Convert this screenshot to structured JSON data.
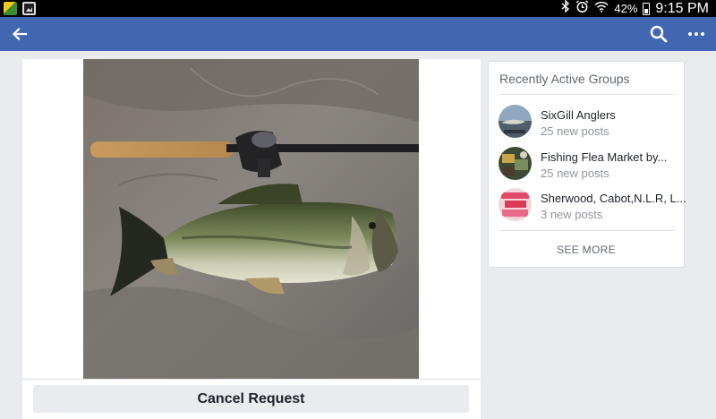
{
  "status_bar": {
    "battery": "42%",
    "time": "9:15 PM",
    "icons": [
      "app-icon",
      "gallery-icon",
      "bluetooth-icon",
      "alarm-icon",
      "wifi-icon",
      "battery-icon"
    ]
  },
  "app_bar": {
    "back_icon": "back-arrow-icon",
    "search_icon": "search-icon",
    "more_icon": "more-icon",
    "color": "#4267b2"
  },
  "post": {
    "photo": "fish-on-rock-photo",
    "cancel_label": "Cancel Request"
  },
  "sidebar": {
    "title": "Recently Active Groups",
    "groups": [
      {
        "name": "SixGill Anglers",
        "meta": "25 new posts"
      },
      {
        "name": "Fishing Flea Market by...",
        "meta": "25 new posts"
      },
      {
        "name": "Sherwood, Cabot,N.L.R, L...",
        "meta": "3 new posts"
      }
    ],
    "see_more": "SEE MORE"
  }
}
